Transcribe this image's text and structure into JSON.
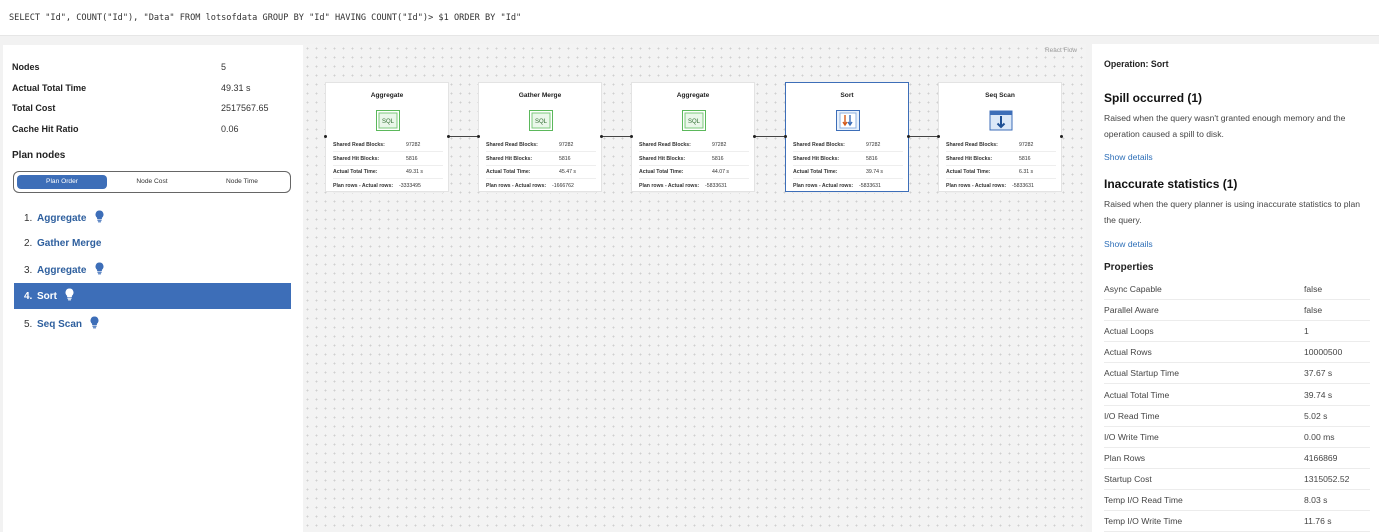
{
  "query": {
    "text": "SELECT \"Id\", COUNT(\"Id\"), \"Data\" FROM lotsofdata GROUP BY \"Id\" HAVING COUNT(\"Id\")> $1 ORDER BY \"Id\""
  },
  "summary": {
    "nodes_label": "Nodes",
    "nodes_value": "5",
    "total_time_label": "Actual Total Time",
    "total_time_value": "49.31 s",
    "total_cost_label": "Total Cost",
    "total_cost_value": "2517567.65",
    "cache_label": "Cache Hit Ratio",
    "cache_value": "0.06"
  },
  "plan_nodes": {
    "title": "Plan nodes",
    "tabs": [
      "Plan Order",
      "Node Cost",
      "Node Time"
    ],
    "active_tab": "Plan Order",
    "items": [
      {
        "num": "1.",
        "label": "Aggregate",
        "has_bulb": true
      },
      {
        "num": "2.",
        "label": "Gather Merge",
        "has_bulb": false
      },
      {
        "num": "3.",
        "label": "Aggregate",
        "has_bulb": true
      },
      {
        "num": "4.",
        "label": "Sort",
        "has_bulb": true
      },
      {
        "num": "5.",
        "label": "Seq Scan",
        "has_bulb": true
      }
    ],
    "selected_index": 3,
    "bulb_color": "#3d6eb8"
  },
  "canvas": {
    "attribution": "React Flow",
    "row_labels": {
      "read": "Shared Read Blocks:",
      "hit": "Shared Hit Blocks:",
      "time": "Actual Total Time:",
      "rows": "Plan rows - Actual rows:"
    },
    "cards": [
      {
        "title": "Aggregate",
        "icon": "sql-icon",
        "read": "97282",
        "hit": "5816",
        "time": "49.31 s",
        "rows": "-3333495"
      },
      {
        "title": "Gather Merge",
        "icon": "sql-icon",
        "read": "97282",
        "hit": "5816",
        "time": "45.47 s",
        "rows": "-1666762"
      },
      {
        "title": "Aggregate",
        "icon": "sql-icon",
        "read": "97282",
        "hit": "5816",
        "time": "44.07 s",
        "rows": "-5833631"
      },
      {
        "title": "Sort",
        "icon": "sort-icon",
        "read": "97282",
        "hit": "5816",
        "time": "39.74 s",
        "rows": "-5833631"
      },
      {
        "title": "Seq Scan",
        "icon": "table-scan-icon",
        "read": "97282",
        "hit": "5816",
        "time": "6.31 s",
        "rows": "-5833631"
      }
    ]
  },
  "details": {
    "operation_label": "Operation: Sort",
    "issues": [
      {
        "title": "Spill occurred (1)",
        "description": "Raised when the query wasn't granted enough memory and the operation caused a spill to disk.",
        "link": "Show details"
      },
      {
        "title": "Inaccurate statistics (1)",
        "description": "Raised when the query planner is using inaccurate statistics to plan the query.",
        "link": "Show details"
      }
    ],
    "properties_title": "Properties",
    "properties": [
      {
        "key": "Async Capable",
        "value": "false"
      },
      {
        "key": "Parallel Aware",
        "value": "false"
      },
      {
        "key": "Actual Loops",
        "value": "1"
      },
      {
        "key": "Actual Rows",
        "value": "10000500"
      },
      {
        "key": "Actual Startup Time",
        "value": "37.67 s"
      },
      {
        "key": "Actual Total Time",
        "value": "39.74 s"
      },
      {
        "key": "I/O Read Time",
        "value": "5.02 s"
      },
      {
        "key": "I/O Write Time",
        "value": "0.00 ms"
      },
      {
        "key": "Plan Rows",
        "value": "4166869"
      },
      {
        "key": "Startup Cost",
        "value": "1315052.52"
      },
      {
        "key": "Temp I/O Read Time",
        "value": "8.03 s"
      },
      {
        "key": "Temp I/O Write Time",
        "value": "11.76 s"
      }
    ]
  }
}
